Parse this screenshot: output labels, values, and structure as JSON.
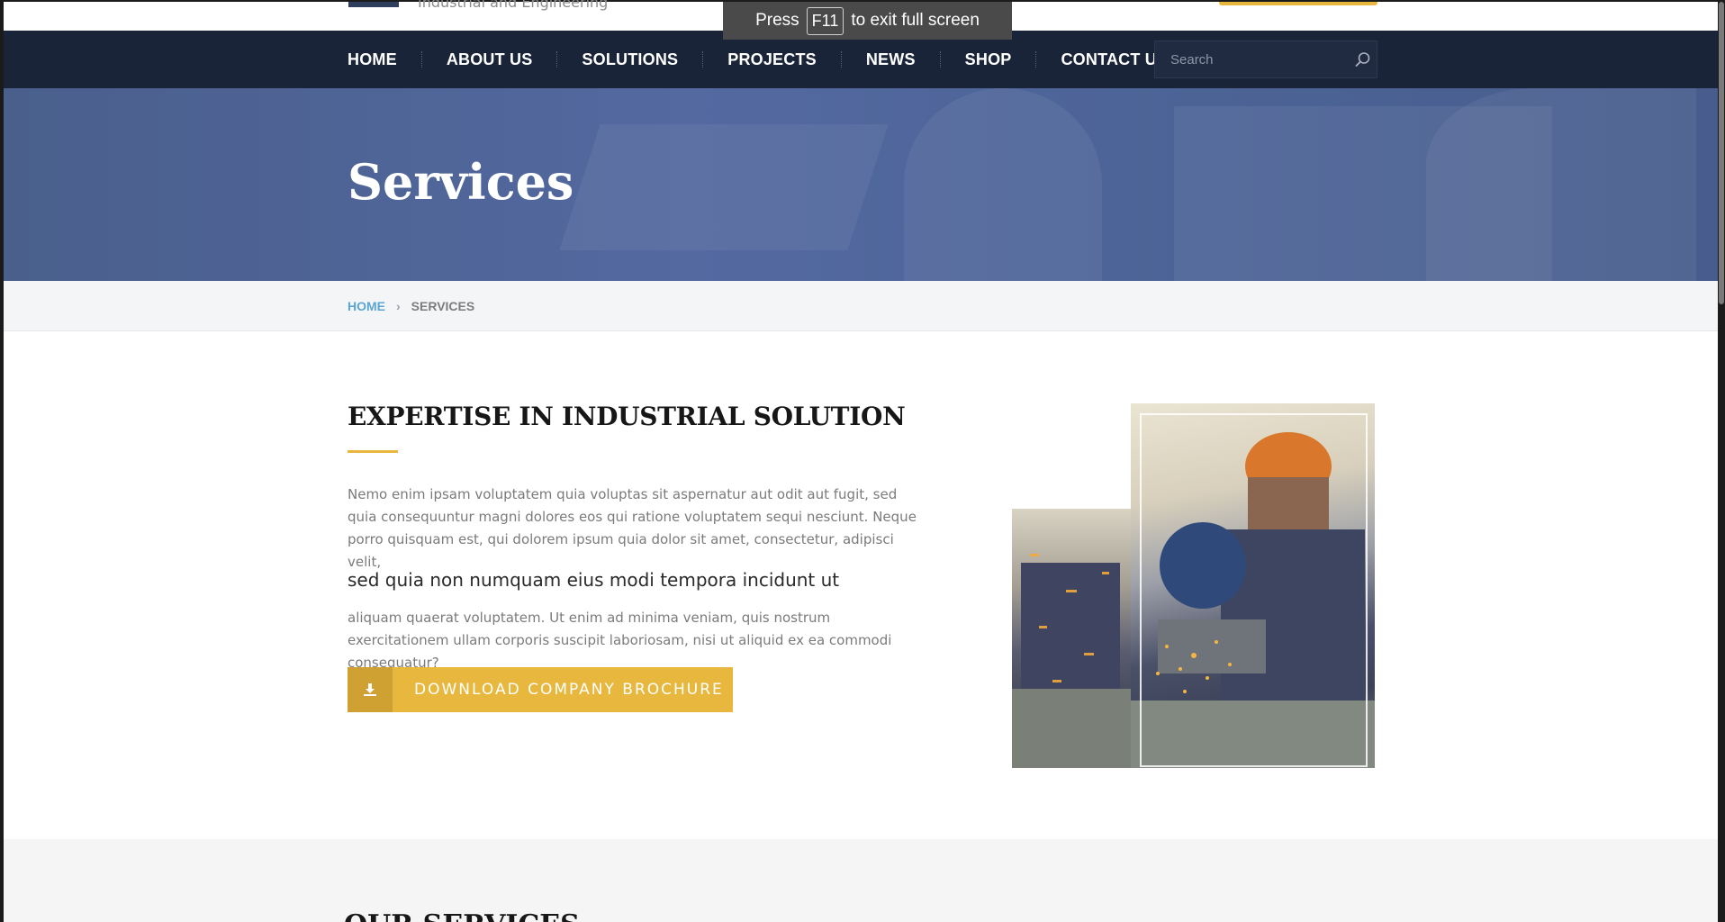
{
  "header": {
    "tagline": "Industrial and Engineering"
  },
  "fullscreen_notice": {
    "prefix": "Press",
    "key": "F11",
    "suffix": "to exit full screen"
  },
  "nav": {
    "items": [
      {
        "label": "HOME"
      },
      {
        "label": "ABOUT US"
      },
      {
        "label": "SOLUTIONS"
      },
      {
        "label": "PROJECTS"
      },
      {
        "label": "NEWS"
      },
      {
        "label": "SHOP"
      },
      {
        "label": "CONTACT US"
      }
    ],
    "search": {
      "placeholder": "Search",
      "icon": "search-icon"
    }
  },
  "hero": {
    "title": "Services"
  },
  "breadcrumb": {
    "home": "HOME",
    "separator": "›",
    "current": "SERVICES"
  },
  "content": {
    "title": "EXPERTISE IN INDUSTRIAL SOLUTION",
    "paragraph1": "Nemo enim ipsam voluptatem quia voluptas sit aspernatur aut odit aut fugit, sed quia consequuntur magni dolores eos qui ratione voluptatem sequi nesciunt. Neque porro quisquam est, qui dolorem ipsum quia dolor sit amet, consectetur, adipisci velit,",
    "lead": "sed quia non numquam eius modi tempora incidunt ut",
    "paragraph2": "aliquam quaerat voluptatem. Ut enim ad minima veniam, quis nostrum exercitationem ullam corporis suscipit laboriosam, nisi ut aliquid ex ea commodi consequatur?",
    "download_button": {
      "label": "DOWNLOAD COMPANY BROCHURE",
      "icon": "download-icon"
    }
  },
  "bottom": {
    "title": "OUR SERVICES"
  },
  "colors": {
    "navbar": "#1a2438",
    "accent": "#e8b83e",
    "hero": "#4d6394",
    "link": "#5aa6d2"
  }
}
